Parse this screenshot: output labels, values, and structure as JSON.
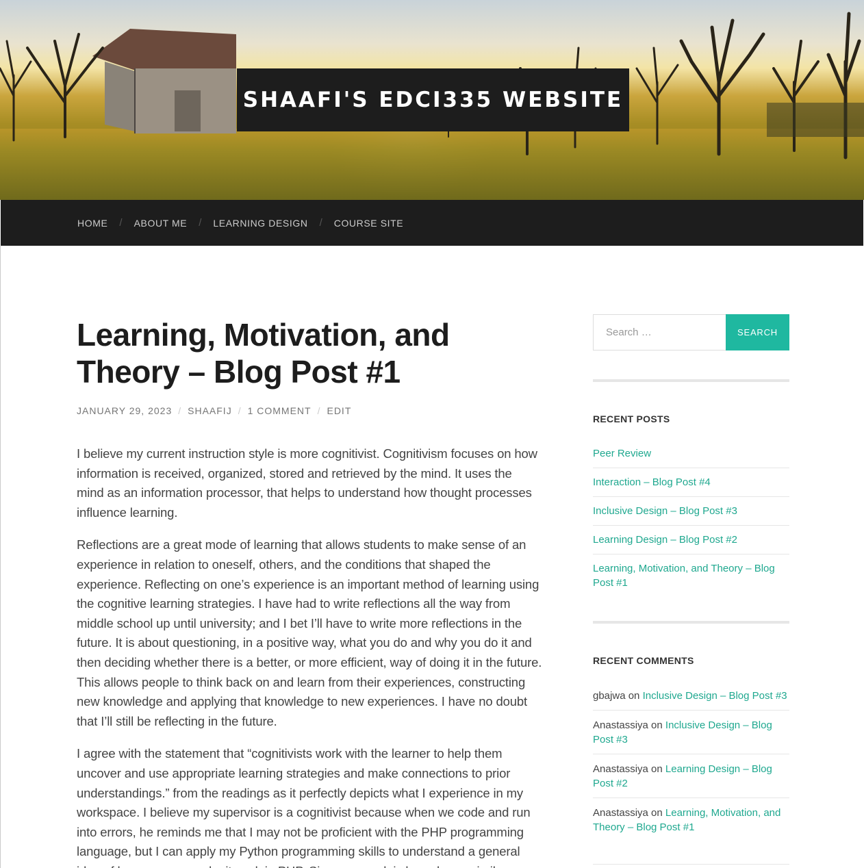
{
  "site": {
    "title": "SHAAFI'S EDCI335 WEBSITE"
  },
  "nav": {
    "items": [
      {
        "label": "HOME"
      },
      {
        "label": "ABOUT ME"
      },
      {
        "label": "LEARNING DESIGN"
      },
      {
        "label": "COURSE SITE"
      }
    ],
    "separator": "/"
  },
  "post": {
    "title": "Learning, Motivation, and Theory – Blog Post #1",
    "meta": {
      "date": "JANUARY 29, 2023",
      "author": "SHAAFIJ",
      "comments": "1 COMMENT",
      "edit": "EDIT",
      "separator": "/"
    },
    "paragraphs": [
      "I believe my current instruction style is more cognitivist. Cognitivism focuses on how information is received, organized, stored and retrieved by the mind. It uses the mind as an information processor, that helps to understand how thought processes influence learning.",
      "Reflections are a great mode of learning that allows students to make sense of an experience in relation to oneself, others, and the conditions that shaped the experience. Reflecting on one’s experience is an important method of learning using the cognitive learning strategies. I have had to write reflections all the way from middle school up until university; and I bet I’ll have to write more reflections in the future. It is about questioning, in a positive way, what you do and why you do it and then deciding whether there is a better, or more efficient, way of doing it in the future. This allows people to think back on and learn from their experiences, constructing new knowledge and applying that knowledge to new experiences. I have no doubt that I’ll still be reflecting in the future.",
      "I agree with the statement that “cognitivists work with the learner to help them uncover and use appropriate learning strategies and make connections to prior understandings.” from the readings as it perfectly depicts what I experience in my workspace. I believe my supervisor is a cognitivist because when we code and run into errors, he reminds me that I may not be proficient with the PHP programming language, but I can apply my Python programming skills to understand a general idea of how one can make it work in PHP. Since my work is based on a similar"
    ]
  },
  "sidebar": {
    "search": {
      "placeholder": "Search …",
      "button_label": "SEARCH"
    },
    "recent_posts": {
      "title": "RECENT POSTS",
      "items": [
        {
          "label": "Peer Review"
        },
        {
          "label": "Interaction – Blog Post #4"
        },
        {
          "label": "Inclusive Design – Blog Post #3"
        },
        {
          "label": "Learning Design – Blog Post #2"
        },
        {
          "label": "Learning, Motivation, and Theory – Blog Post #1"
        }
      ]
    },
    "recent_comments": {
      "title": "RECENT COMMENTS",
      "connector": "on",
      "items": [
        {
          "author": "gbajwa",
          "post": "Inclusive Design – Blog Post #3"
        },
        {
          "author": "Anastassiya",
          "post": "Inclusive Design – Blog Post #3"
        },
        {
          "author": "Anastassiya",
          "post": "Learning Design – Blog Post #2"
        },
        {
          "author": "Anastassiya",
          "post": "Learning, Motivation, and Theory – Blog Post #1"
        }
      ]
    }
  },
  "colors": {
    "accent": "#1fb8a0",
    "link": "#1fa88f",
    "dark": "#1d1d1d"
  }
}
